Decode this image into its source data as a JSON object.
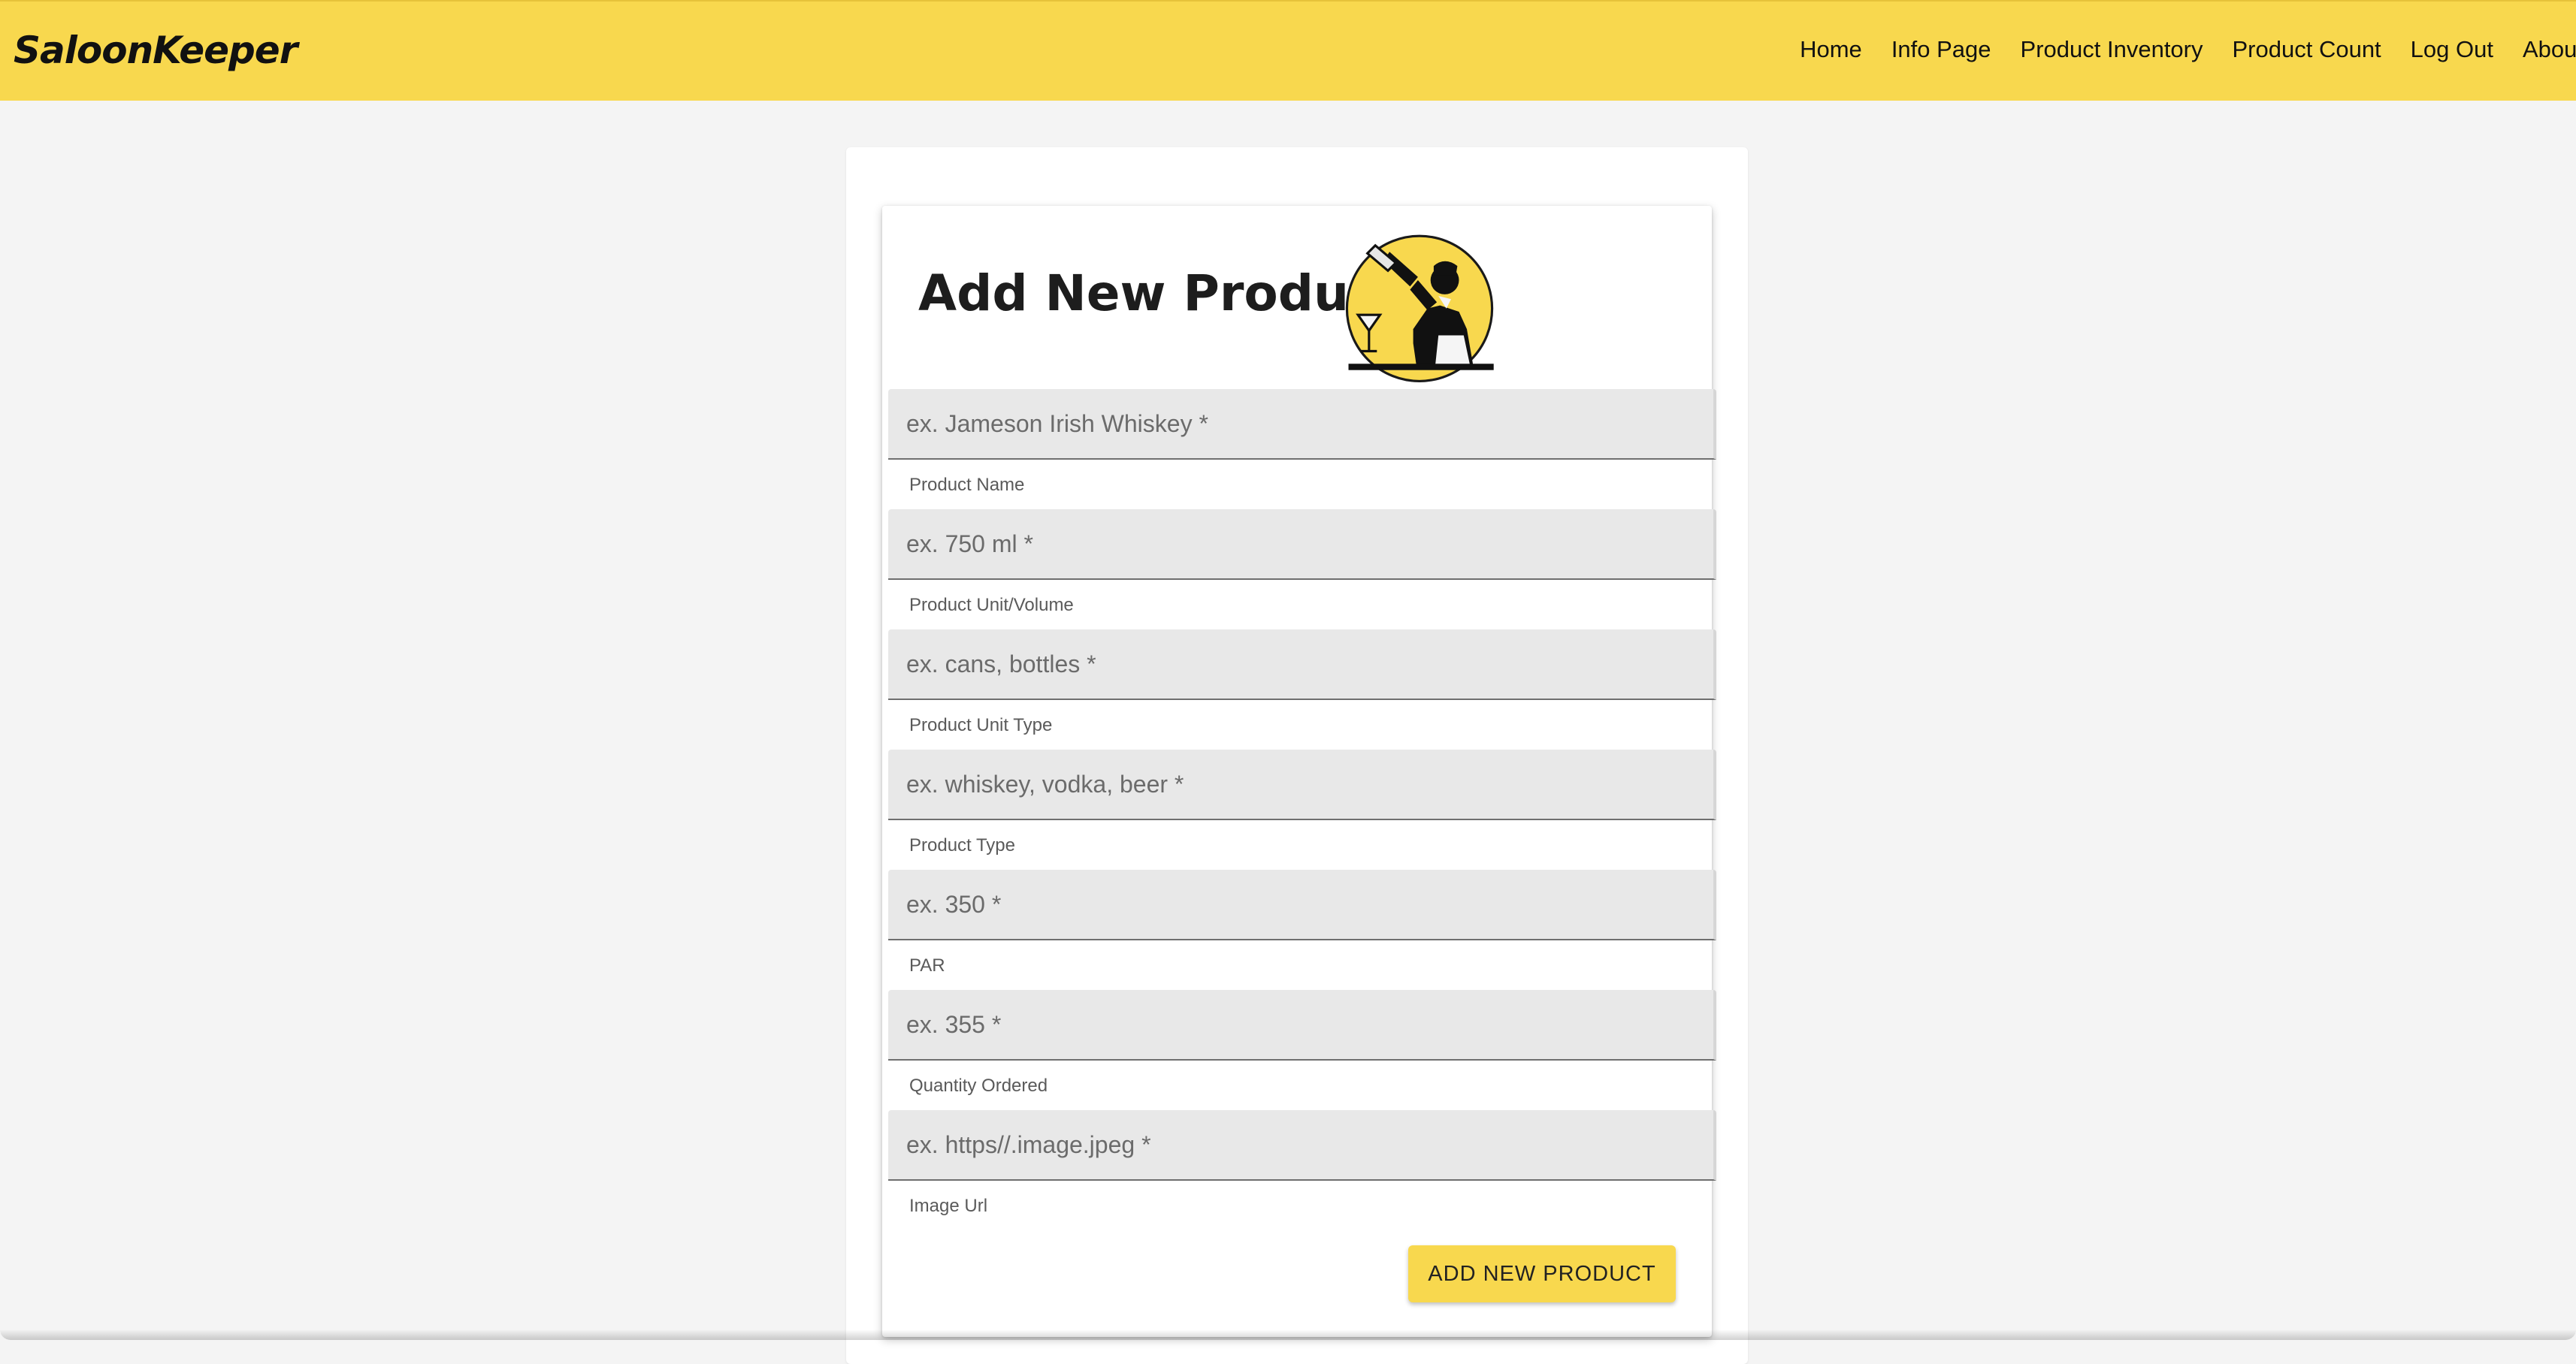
{
  "header": {
    "brand": "SaloonKeeper",
    "nav": [
      "Home",
      "Info Page",
      "Product Inventory",
      "Product Count",
      "Log Out",
      "About"
    ]
  },
  "form": {
    "title": "Add New Product",
    "fields": [
      {
        "placeholder": "ex. Jameson Irish Whiskey *",
        "helper": "Product Name"
      },
      {
        "placeholder": "ex. 750 ml *",
        "helper": "Product Unit/Volume"
      },
      {
        "placeholder": "ex. cans, bottles *",
        "helper": "Product Unit Type"
      },
      {
        "placeholder": "ex. whiskey, vodka, beer *",
        "helper": "Product Type"
      },
      {
        "placeholder": "ex. 350 *",
        "helper": "PAR"
      },
      {
        "placeholder": "ex. 355 *",
        "helper": "Quantity Ordered"
      },
      {
        "placeholder": "ex. https//.image.jpeg *",
        "helper": "Image Url"
      }
    ],
    "submit_label": "ADD NEW PRODUCT"
  },
  "theme": {
    "accent": "#f8d84e",
    "background": "#f4f4f4",
    "field_background": "#e8e8e8"
  },
  "icons": {
    "logo": "bartender-logo-icon"
  }
}
